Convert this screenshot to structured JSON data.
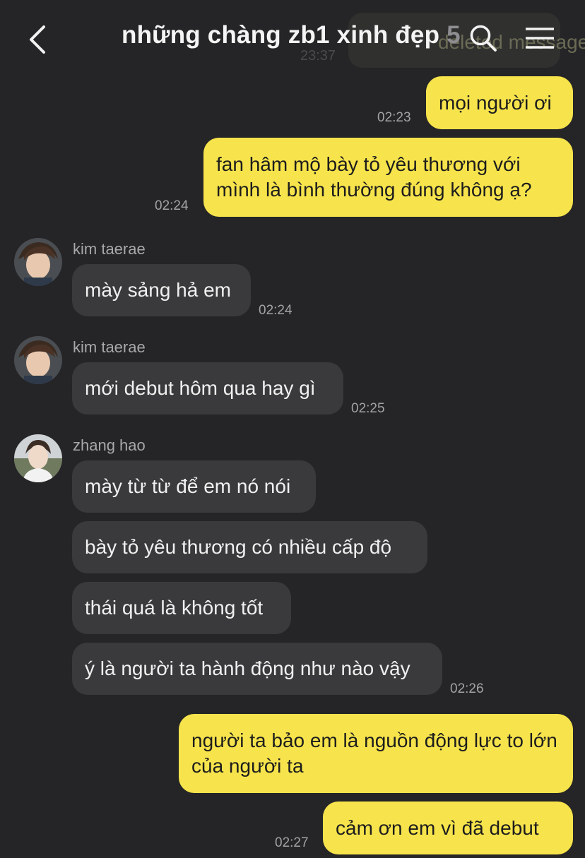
{
  "header": {
    "title": "những chàng zb1 xinh đẹp",
    "member_count": "5"
  },
  "ghost": {
    "text": "deleted message",
    "time": "23:37"
  },
  "messages": [
    {
      "sender": "me",
      "text": "mọi người ơi",
      "time": "02:23"
    },
    {
      "sender": "me",
      "text": "fan hâm mộ bày tỏ yêu thương với mình là bình thường đúng không ạ?",
      "time": "02:24"
    },
    {
      "sender": "kim taerae",
      "text": "mày sảng hả em",
      "time": "02:24"
    },
    {
      "sender": "kim taerae",
      "text": "mới debut hôm qua hay gì",
      "time": "02:25"
    },
    {
      "sender": "zhang hao",
      "text": "mày từ từ để em nó nói"
    },
    {
      "sender": "zhang hao",
      "text": "bày tỏ yêu thương có nhiều cấp độ"
    },
    {
      "sender": "zhang hao",
      "text": "thái quá là không tốt"
    },
    {
      "sender": "zhang hao",
      "text": "ý là người ta hành động như nào vậy",
      "time": "02:26"
    },
    {
      "sender": "me",
      "text": "người ta bảo em là nguồn động lực to lớn của người ta"
    },
    {
      "sender": "me",
      "text": "cảm ơn em vì đã debut",
      "time": "02:27"
    }
  ],
  "colors": {
    "my_bubble": "#f7e44c",
    "their_bubble": "#3a3a3c",
    "background": "#252527"
  },
  "icons": {
    "back": "chevron-left-icon",
    "search": "search-icon",
    "menu": "hamburger-menu-icon"
  }
}
